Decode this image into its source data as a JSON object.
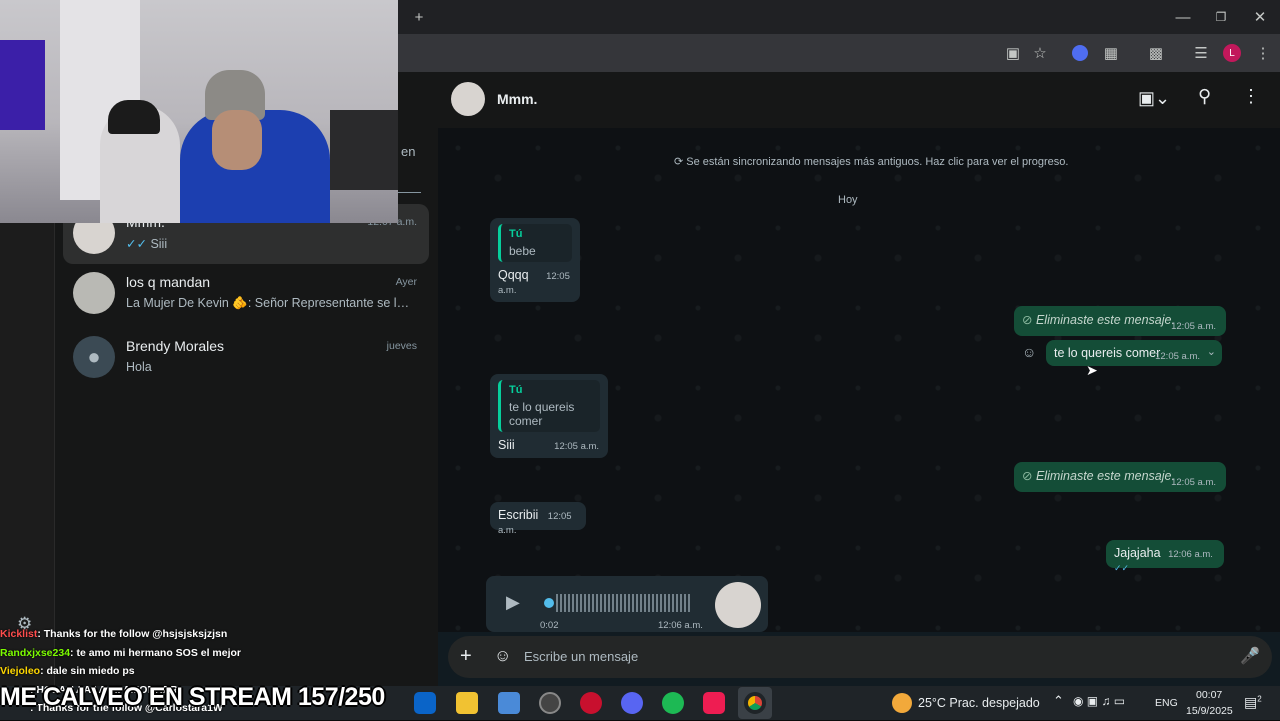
{
  "browser": {
    "new_tab": "+",
    "profile_initial": "L"
  },
  "sidebar": {
    "partial_label": "en"
  },
  "chats": [
    {
      "name": "Mmm.",
      "preview": "Siii",
      "time": "12:07 a.m.",
      "active": true
    },
    {
      "name": "los q mandan",
      "preview": "La Mujer De Kevin 🫵: Señor Representante se les inf...",
      "time": "Ayer",
      "active": false
    },
    {
      "name": "Brendy Morales",
      "preview": "Hola",
      "time": "jueves",
      "active": false
    }
  ],
  "conversation": {
    "title": "Mmm.",
    "sync_notice": "Se están sincronizando mensajes más antiguos. Haz clic para ver el progreso.",
    "date_divider": "Hoy",
    "messages": [
      {
        "dir": "in",
        "quote_author": "Tú",
        "quote_text": "bebe",
        "text": "Qqqq",
        "time": "12:05 a.m."
      },
      {
        "dir": "out",
        "deleted": true,
        "text": "Eliminaste este mensaje.",
        "time": "12:05 a.m."
      },
      {
        "dir": "out",
        "text": "te lo quereis comer",
        "time": "12:05 a.m."
      },
      {
        "dir": "in",
        "quote_author": "Tú",
        "quote_text": "te lo quereis comer",
        "text": "Siii",
        "time": "12:05 a.m."
      },
      {
        "dir": "out",
        "deleted": true,
        "text": "Eliminaste este mensaje.",
        "time": "12:05 a.m."
      },
      {
        "dir": "in",
        "text": "Escribii",
        "time": "12:05 a.m."
      },
      {
        "dir": "out",
        "text": "Jajajaha",
        "time": "12:06 a.m."
      },
      {
        "dir": "in",
        "voice": true,
        "duration": "0:02",
        "time": "12:06 a.m."
      }
    ],
    "composer_placeholder": "Escribe un mensaje"
  },
  "stream": {
    "chat": [
      {
        "user": "Kicklist",
        "text": ": Thanks for the follow @hsjsjsksjzjsn",
        "color": "#ff4d4d"
      },
      {
        "user": "Randxjxse234",
        "text": ": te amo mi hermano SOS el mejor",
        "color": "#7cfc00"
      },
      {
        "user": "Viejoleo",
        "text": ": dale sin miedo ps",
        "color": "#ffd700"
      },
      {
        "user": "",
        "text": ": HOLA AAAAA MI AMORRRR",
        "color": "#ffffff"
      },
      {
        "user": "",
        "text": ": Thanks for the follow @Carlostara1W",
        "color": "#ffffff"
      }
    ],
    "banner": "ME CALVEO EN STREAM 157/250"
  },
  "taskbar": {
    "weather": "25°C  Prac. despejado",
    "lang": "ENG",
    "time": "00:07",
    "date": "15/9/2025",
    "notif_count": "2"
  },
  "colors": {
    "accent": "#06cf9c",
    "outgoing": "#144d37",
    "incoming": "#202c33"
  }
}
